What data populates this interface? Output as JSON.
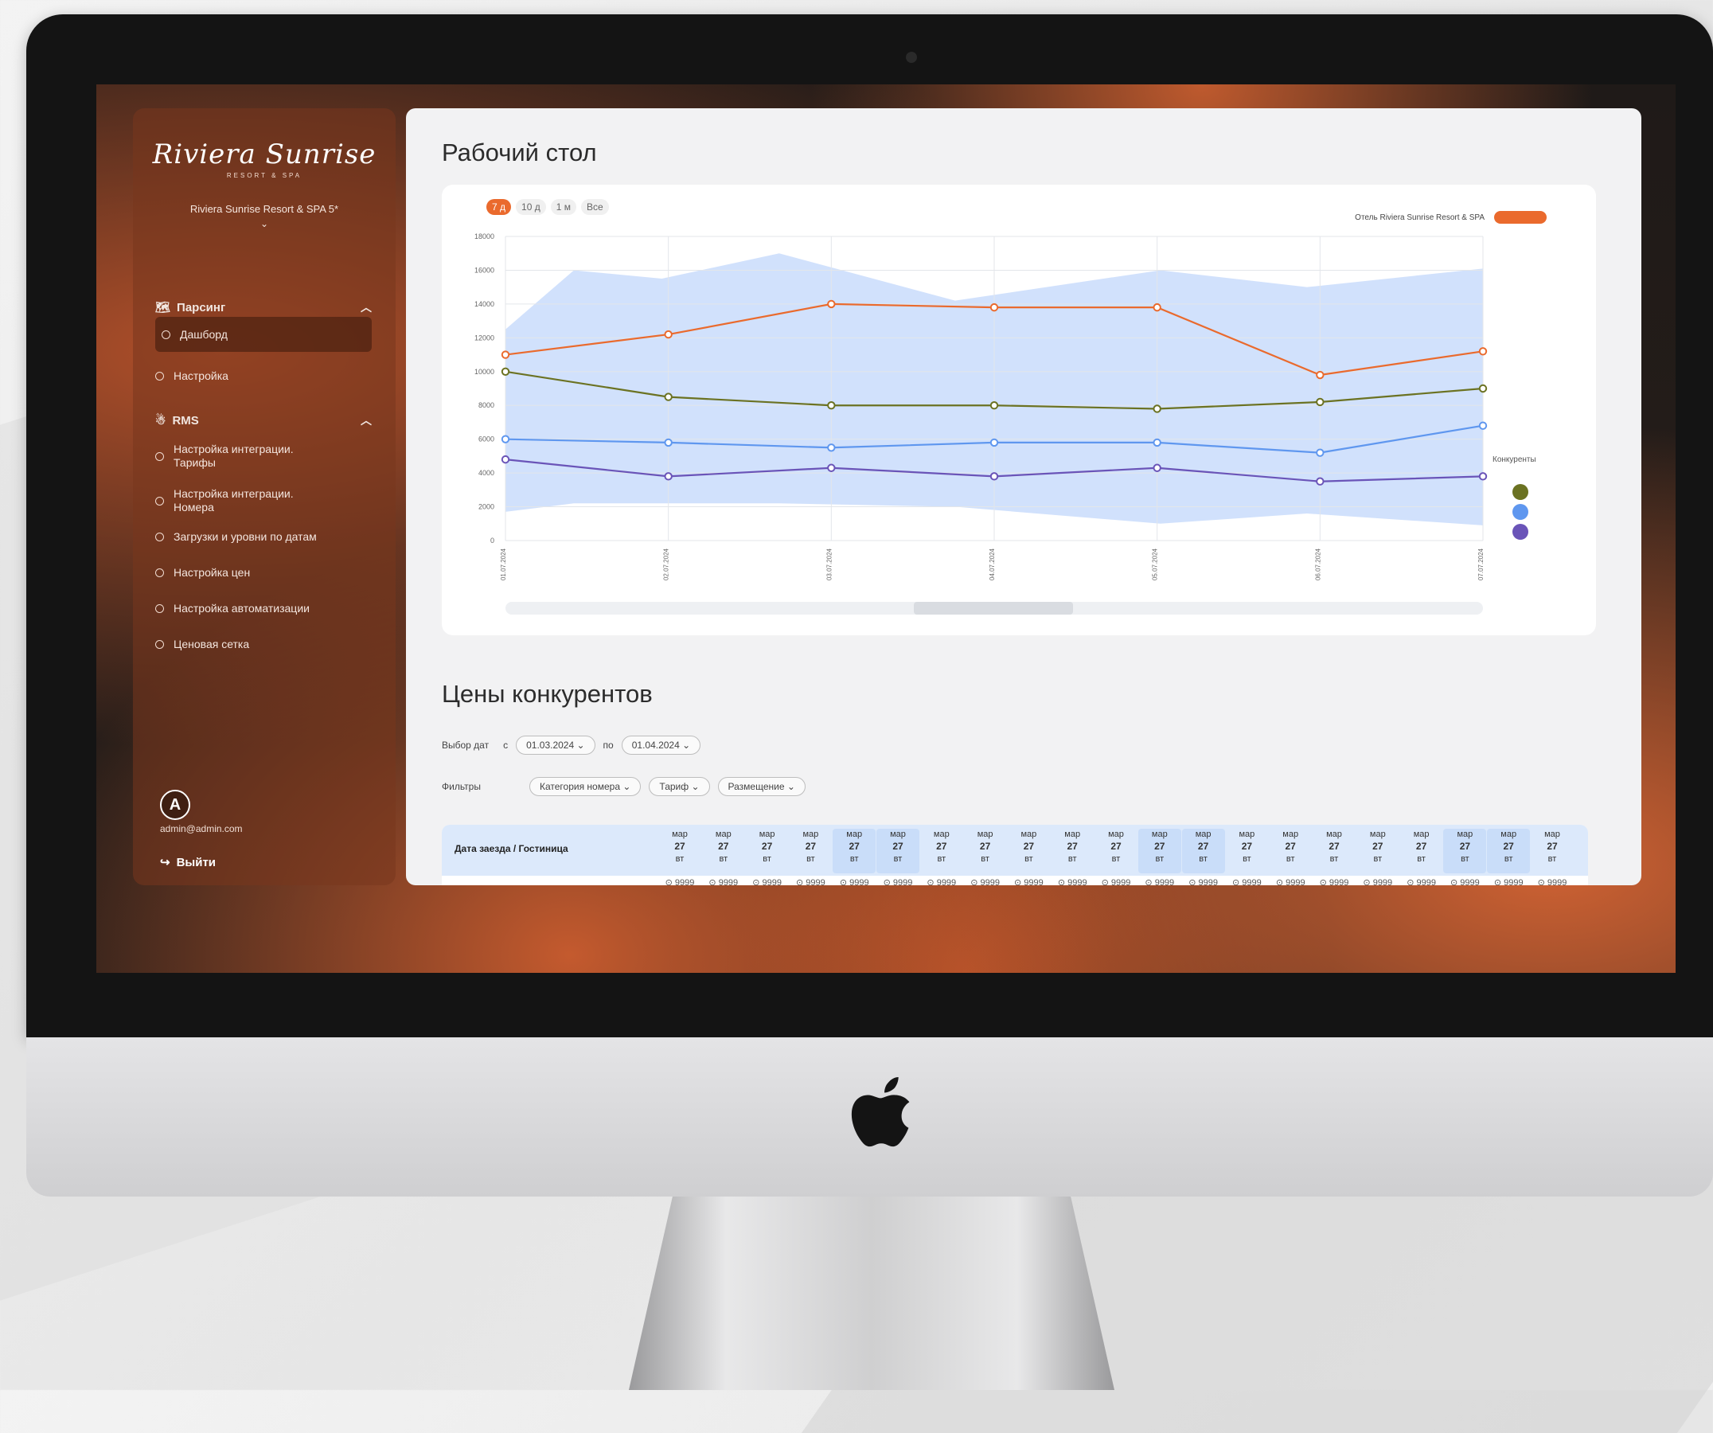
{
  "app": {
    "logo_text": "Riviera Sunrise",
    "logo_sub": "RESORT & SPA",
    "hotel_selector": "Riviera Sunrise Resort & SPA 5*"
  },
  "sidebar": {
    "sections": [
      {
        "title": "Парсинг",
        "items": [
          "Дашборд",
          "Настройка"
        ]
      },
      {
        "title": "RMS",
        "items": [
          "Настройка интеграции. Тарифы",
          "Настройка интеграции. Номера",
          "Загрузки и уровни по датам",
          "Настройка цен",
          "Настройка автоматизации",
          "Ценовая сетка"
        ]
      }
    ],
    "active_item": "Дашборд",
    "avatar_letter": "A",
    "user_email": "admin@admin.com",
    "logout_label": "Выйти"
  },
  "dashboard": {
    "title": "Рабочий стол",
    "range_tabs": [
      "7 д",
      "10 д",
      "1 м",
      "Все"
    ],
    "active_range": "7 д",
    "legend_hotel": "Отель Riviera Sunrise Resort & SPA",
    "legend_competitors": "Конкуренты"
  },
  "chart_data": {
    "type": "line",
    "x": [
      "01.07.2024",
      "02.07.2024",
      "03.07.2024",
      "04.07.2024",
      "05.07.2024",
      "06.07.2024",
      "07.07.2024"
    ],
    "ylim": [
      0,
      18000
    ],
    "yticks": [
      0,
      2000,
      4000,
      6000,
      8000,
      10000,
      12000,
      14000,
      16000,
      18000
    ],
    "series": [
      {
        "color": "#ea6a2d",
        "values": [
          11000,
          12200,
          14000,
          13800,
          13800,
          9800,
          11200
        ]
      },
      {
        "color": "#6b7222",
        "values": [
          10000,
          8500,
          8000,
          8000,
          7800,
          8200,
          9000
        ]
      },
      {
        "color": "#5f97ef",
        "values": [
          6000,
          5800,
          5500,
          5800,
          5800,
          5200,
          6800
        ]
      },
      {
        "color": "#6a54b8",
        "values": [
          4800,
          3800,
          4300,
          3800,
          4300,
          3500,
          3800
        ]
      }
    ],
    "band": {
      "color": "#c6d9fb",
      "upper": [
        12500,
        16000,
        15500,
        17000,
        14200,
        16000,
        15000,
        16100
      ],
      "lower": [
        1700,
        2200,
        2200,
        2200,
        2000,
        1000,
        1600,
        900
      ],
      "x_fraction": [
        0,
        0.07,
        0.16,
        0.28,
        0.46,
        0.67,
        0.82,
        1
      ]
    },
    "grid": true,
    "legend": "right"
  },
  "competitors": {
    "title": "Цены конкурентов",
    "date_label": "Выбор дат",
    "from_label": "с",
    "from_date": "01.03.2024",
    "to_label": "по",
    "to_date": "01.04.2024",
    "filters_label": "Фильтры",
    "filters": [
      "Категория номера",
      "Тариф",
      "Размещение"
    ],
    "table_header": "Дата заезда / Гостиница",
    "date_col": {
      "month": "мар",
      "day": "27",
      "weekday": "вт"
    },
    "price": "9999",
    "columns": 21,
    "highlight_columns": [
      4,
      5,
      11,
      12,
      18,
      19
    ]
  }
}
